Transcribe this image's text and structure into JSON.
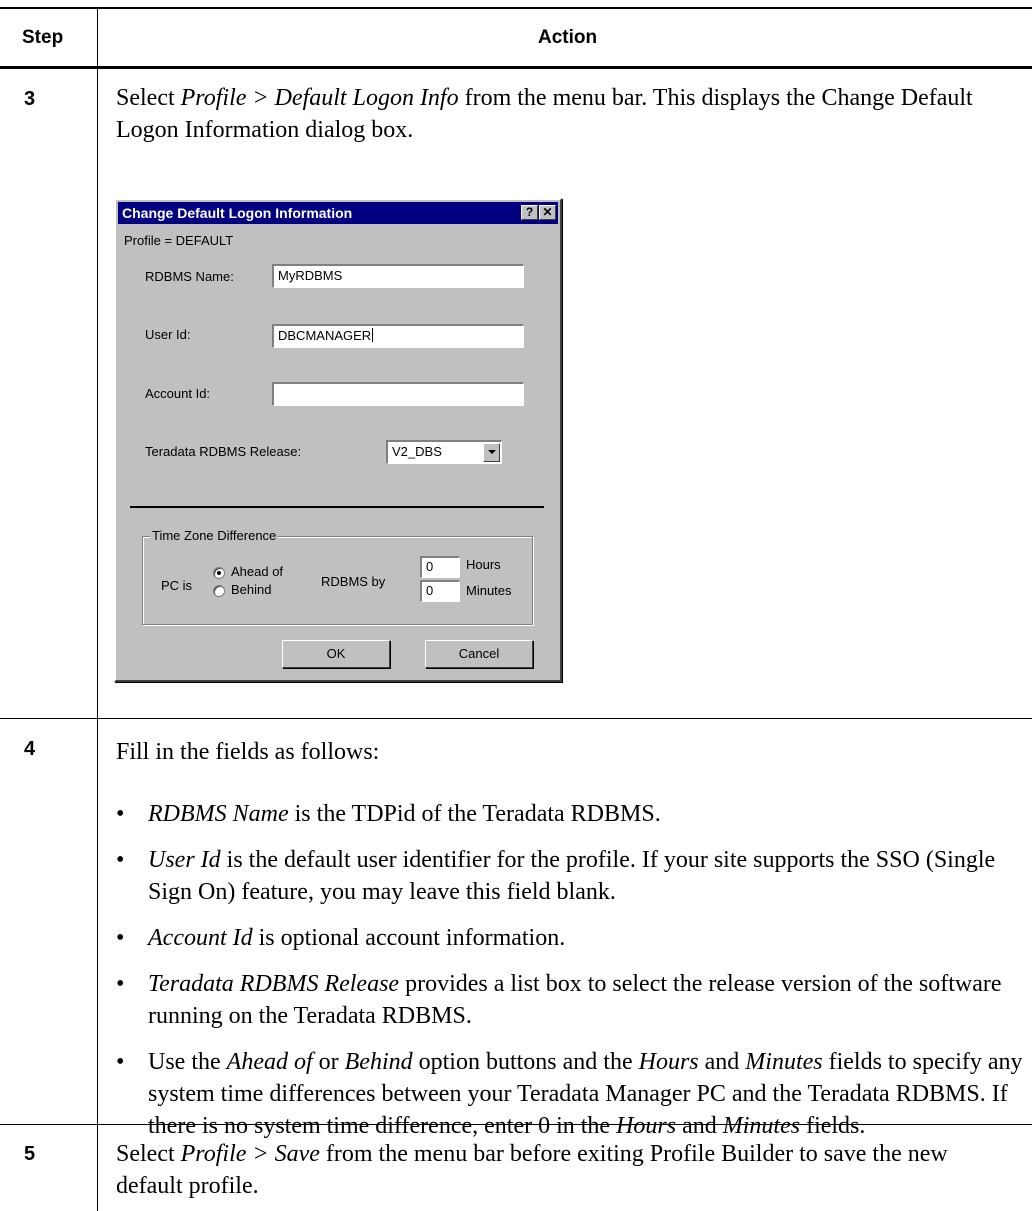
{
  "table": {
    "col_step": "Step",
    "col_action": "Action"
  },
  "steps": [
    {
      "number": "3",
      "text_parts": [
        "Select ",
        "Profile > Default Logon Info",
        " from the menu bar. This displays the Change Default Logon Information dialog box."
      ]
    },
    {
      "number": "4",
      "intro": "Fill in the fields as follows:",
      "bullets": [
        {
          "em": "RDBMS Name",
          "rest": " is the TDPid of the Teradata RDBMS."
        },
        {
          "em": "User Id",
          "rest": " is the default user identifier for the profile. If your site supports the SSO (Single Sign On) feature, you may leave this field blank."
        },
        {
          "em": "Account Id",
          "rest": " is optional account information."
        },
        {
          "em": "Teradata RDBMS Release",
          "rest": " provides a list box to select the release version of the software running on the Teradata RDBMS."
        }
      ],
      "last_bullet": {
        "p1": "Use the ",
        "e1": "Ahead of",
        "p2": " or ",
        "e2": "Behind",
        "p3": " option buttons and the ",
        "e3": "Hours",
        "p4": " and ",
        "e4": "Minutes",
        "p5": " fields to specify any system time differences between your Teradata Manager PC and the Teradata RDBMS. If there is no system time difference, enter 0 in the ",
        "e5": "Hours",
        "p6": " and ",
        "e6": "Minutes",
        "p7": " fields."
      },
      "bullet_char": "•"
    },
    {
      "number": "5",
      "text_parts": [
        "Select ",
        "Profile > Save",
        " from the menu bar before exiting Profile Builder to save the new default profile."
      ]
    }
  ],
  "dialog": {
    "title": "Change Default Logon Information",
    "help_btn": "?",
    "close_btn": "✕",
    "profile_line": "Profile =  DEFAULT",
    "rdbms_name_label": "RDBMS Name:",
    "rdbms_name_value": "MyRDBMS",
    "user_id_label": "User Id:",
    "user_id_value": "DBCMANAGER",
    "account_id_label": "Account Id:",
    "account_id_value": "",
    "release_label": "Teradata RDBMS Release:",
    "release_value": "V2_DBS",
    "group_title": "Time Zone Difference",
    "pc_is": "PC is",
    "ahead_of": "Ahead of",
    "behind": "Behind",
    "rdbms_by": "RDBMS by",
    "hours_value": "0",
    "hours_label": "Hours",
    "minutes_value": "0",
    "minutes_label": "Minutes",
    "ok": "OK",
    "cancel": "Cancel"
  }
}
